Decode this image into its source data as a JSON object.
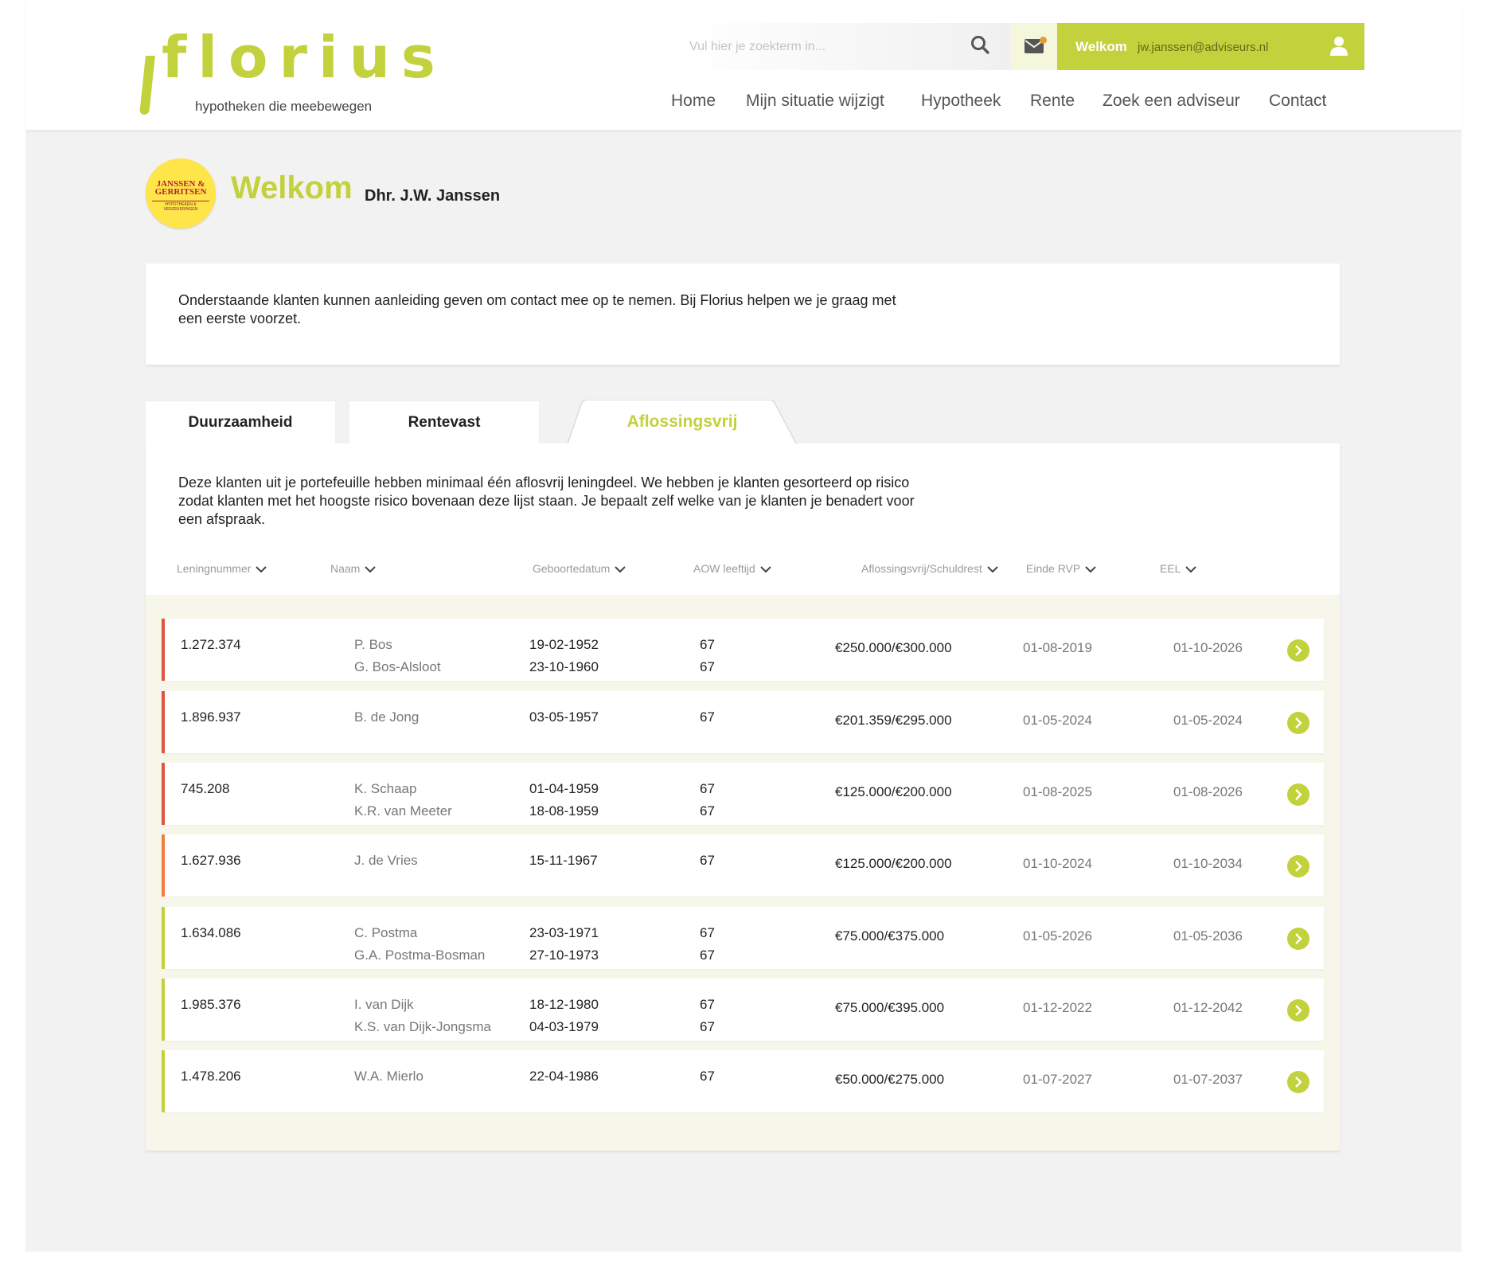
{
  "colors": {
    "brand": "#c3d13c",
    "risk_high": "#e0533f",
    "risk_medium": "#ee7f3f",
    "risk_low": "#c3d13c"
  },
  "logo": {
    "word": "florius",
    "tagline": "hypotheken die meebewegen"
  },
  "search": {
    "placeholder": "Vul hier je zoekterm in...",
    "icon": "search-icon"
  },
  "mail": {
    "icon": "envelope-icon"
  },
  "user": {
    "welcome": "Welkom",
    "email": "jw.janssen@adviseurs.nl",
    "icon": "user-icon"
  },
  "nav": [
    "Home",
    "Mijn situatie wijzigt",
    "Hypotheek",
    "Rente",
    "Zoek een adviseur",
    "Contact"
  ],
  "welcome": {
    "title": "Welkom",
    "name": "Dhr. J.W. Janssen",
    "badge_line1": "JANSSEN &",
    "badge_line2": "GERRITSEN",
    "badge_sub": "HYPOTHEKEN & VERZEKERINGEN"
  },
  "intro": "Onderstaande klanten kunnen aanleiding geven om contact mee op te nemen. Bij Florius helpen we je graag met een eerste voorzet.",
  "tabs": [
    {
      "label": "Duurzaamheid",
      "active": false
    },
    {
      "label": "Rentevast",
      "active": false
    },
    {
      "label": "Aflossingsvrij",
      "active": true
    }
  ],
  "panel_text": "Deze klanten uit je portefeuille hebben minimaal één aflosvrij leningdeel. We hebben je klanten gesorteerd op risico zodat klanten met het hoogste risico bovenaan deze lijst staan. Je bepaalt zelf welke van je klanten je benadert voor een afspraak.",
  "columns": [
    "Leningnummer",
    "Naam",
    "Geboortedatum",
    "AOW leeftijd",
    "Aflossingsvrij/Schuldrest",
    "Einde RVP",
    "EEL"
  ],
  "rows": [
    {
      "risk": "high",
      "loan": "1.272.374",
      "names": [
        "P. Bos",
        "G. Bos-Alsloot"
      ],
      "births": [
        "19-02-1952",
        "23-10-1960"
      ],
      "aow": [
        "67",
        "67"
      ],
      "amount": "€250.000/€300.000",
      "rvp": "01-08-2019",
      "eel": "01-10-2026"
    },
    {
      "risk": "high",
      "loan": "1.896.937",
      "names": [
        "B. de Jong"
      ],
      "births": [
        "03-05-1957"
      ],
      "aow": [
        "67"
      ],
      "amount": "€201.359/€295.000",
      "rvp": "01-05-2024",
      "eel": "01-05-2024"
    },
    {
      "risk": "high",
      "loan": "745.208",
      "names": [
        "K. Schaap",
        "K.R. van Meeter"
      ],
      "births": [
        "01-04-1959",
        "18-08-1959"
      ],
      "aow": [
        "67",
        "67"
      ],
      "amount": "€125.000/€200.000",
      "rvp": "01-08-2025",
      "eel": "01-08-2026"
    },
    {
      "risk": "medium",
      "loan": "1.627.936",
      "names": [
        "J. de Vries"
      ],
      "births": [
        "15-11-1967"
      ],
      "aow": [
        "67"
      ],
      "amount": "€125.000/€200.000",
      "rvp": "01-10-2024",
      "eel": "01-10-2034"
    },
    {
      "risk": "low",
      "loan": "1.634.086",
      "names": [
        "C. Postma",
        "G.A. Postma-Bosman"
      ],
      "births": [
        "23-03-1971",
        "27-10-1973"
      ],
      "aow": [
        "67",
        "67"
      ],
      "amount": "€75.000/€375.000",
      "rvp": "01-05-2026",
      "eel": "01-05-2036"
    },
    {
      "risk": "low",
      "loan": "1.985.376",
      "names": [
        "I. van Dijk",
        "K.S. van Dijk-Jongsma"
      ],
      "births": [
        "18-12-1980",
        "04-03-1979"
      ],
      "aow": [
        "67",
        "67"
      ],
      "amount": "€75.000/€395.000",
      "rvp": "01-12-2022",
      "eel": "01-12-2042"
    },
    {
      "risk": "low",
      "loan": "1.478.206",
      "names": [
        "W.A. Mierlo"
      ],
      "births": [
        "22-04-1986"
      ],
      "aow": [
        "67"
      ],
      "amount": "€50.000/€275.000",
      "rvp": "01-07-2027",
      "eel": "01-07-2037"
    }
  ]
}
